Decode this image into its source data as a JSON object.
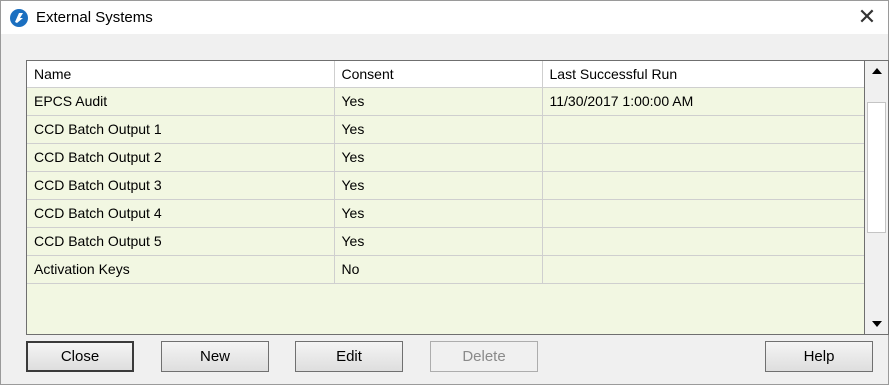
{
  "window": {
    "title": "External Systems",
    "close_glyph": "✕"
  },
  "grid": {
    "columns": [
      "Name",
      "Consent",
      "Last Successful Run"
    ],
    "rows": [
      {
        "name": "EPCS Audit",
        "consent": "Yes",
        "last_run": "11/30/2017 1:00:00 AM"
      },
      {
        "name": "CCD Batch Output 1",
        "consent": "Yes",
        "last_run": ""
      },
      {
        "name": "CCD Batch Output 2",
        "consent": "Yes",
        "last_run": ""
      },
      {
        "name": "CCD Batch Output 3",
        "consent": "Yes",
        "last_run": ""
      },
      {
        "name": "CCD Batch Output 4",
        "consent": "Yes",
        "last_run": ""
      },
      {
        "name": "CCD Batch Output 5",
        "consent": "Yes",
        "last_run": ""
      },
      {
        "name": "Activation Keys",
        "consent": "No",
        "last_run": ""
      }
    ],
    "row_background": "#f2f7e2"
  },
  "buttons": {
    "close": "Close",
    "new": "New",
    "edit": "Edit",
    "delete": "Delete",
    "help": "Help"
  },
  "colors": {
    "app_icon": "#1b6fc0"
  }
}
